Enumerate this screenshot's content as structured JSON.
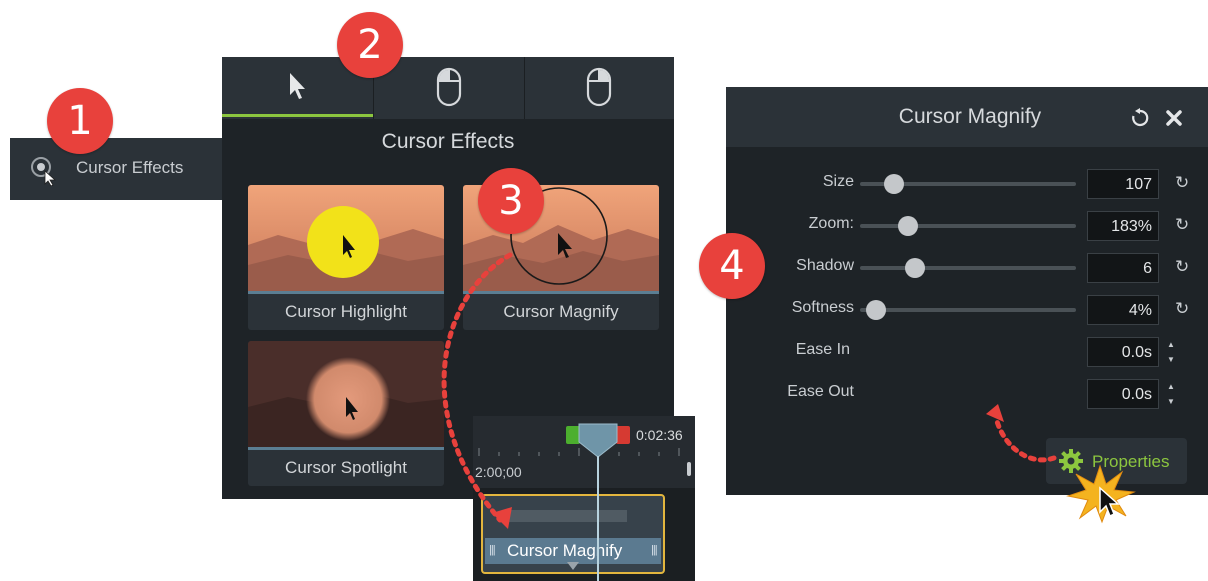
{
  "callouts": [
    "1",
    "2",
    "3",
    "4"
  ],
  "tools_panel": {
    "item_label": "Cursor Effects"
  },
  "effects_panel": {
    "tabs": [
      {
        "icon": "cursor-arrow-icon",
        "active": true
      },
      {
        "icon": "mouse-left-click-icon",
        "active": false
      },
      {
        "icon": "mouse-right-click-icon",
        "active": false
      }
    ],
    "title": "Cursor Effects",
    "effects": [
      {
        "name": "Cursor Highlight"
      },
      {
        "name": "Cursor Magnify"
      },
      {
        "name": "Cursor Spotlight"
      }
    ]
  },
  "timeline": {
    "time_right": "0:02:36",
    "time_left": "2:00;00",
    "clip_label": "Cursor Magnify"
  },
  "properties_panel": {
    "title": "Cursor Magnify",
    "properties": [
      {
        "label": "Size",
        "value": "107",
        "level": 0.11
      },
      {
        "label": "Zoom:",
        "value": "183%",
        "level": 0.17
      },
      {
        "label": "Shadow",
        "value": "6",
        "level": 0.2
      },
      {
        "label": "Softness",
        "value": "4%",
        "level": 0.04
      }
    ],
    "ease": [
      {
        "label": "Ease In",
        "value": "0.0s"
      },
      {
        "label": "Ease Out",
        "value": "0.0s"
      }
    ],
    "properties_button": "Properties"
  },
  "colors": {
    "accent_green": "#8cc63f",
    "callout_red": "#e8413c",
    "clip_border": "#e3b63e"
  }
}
